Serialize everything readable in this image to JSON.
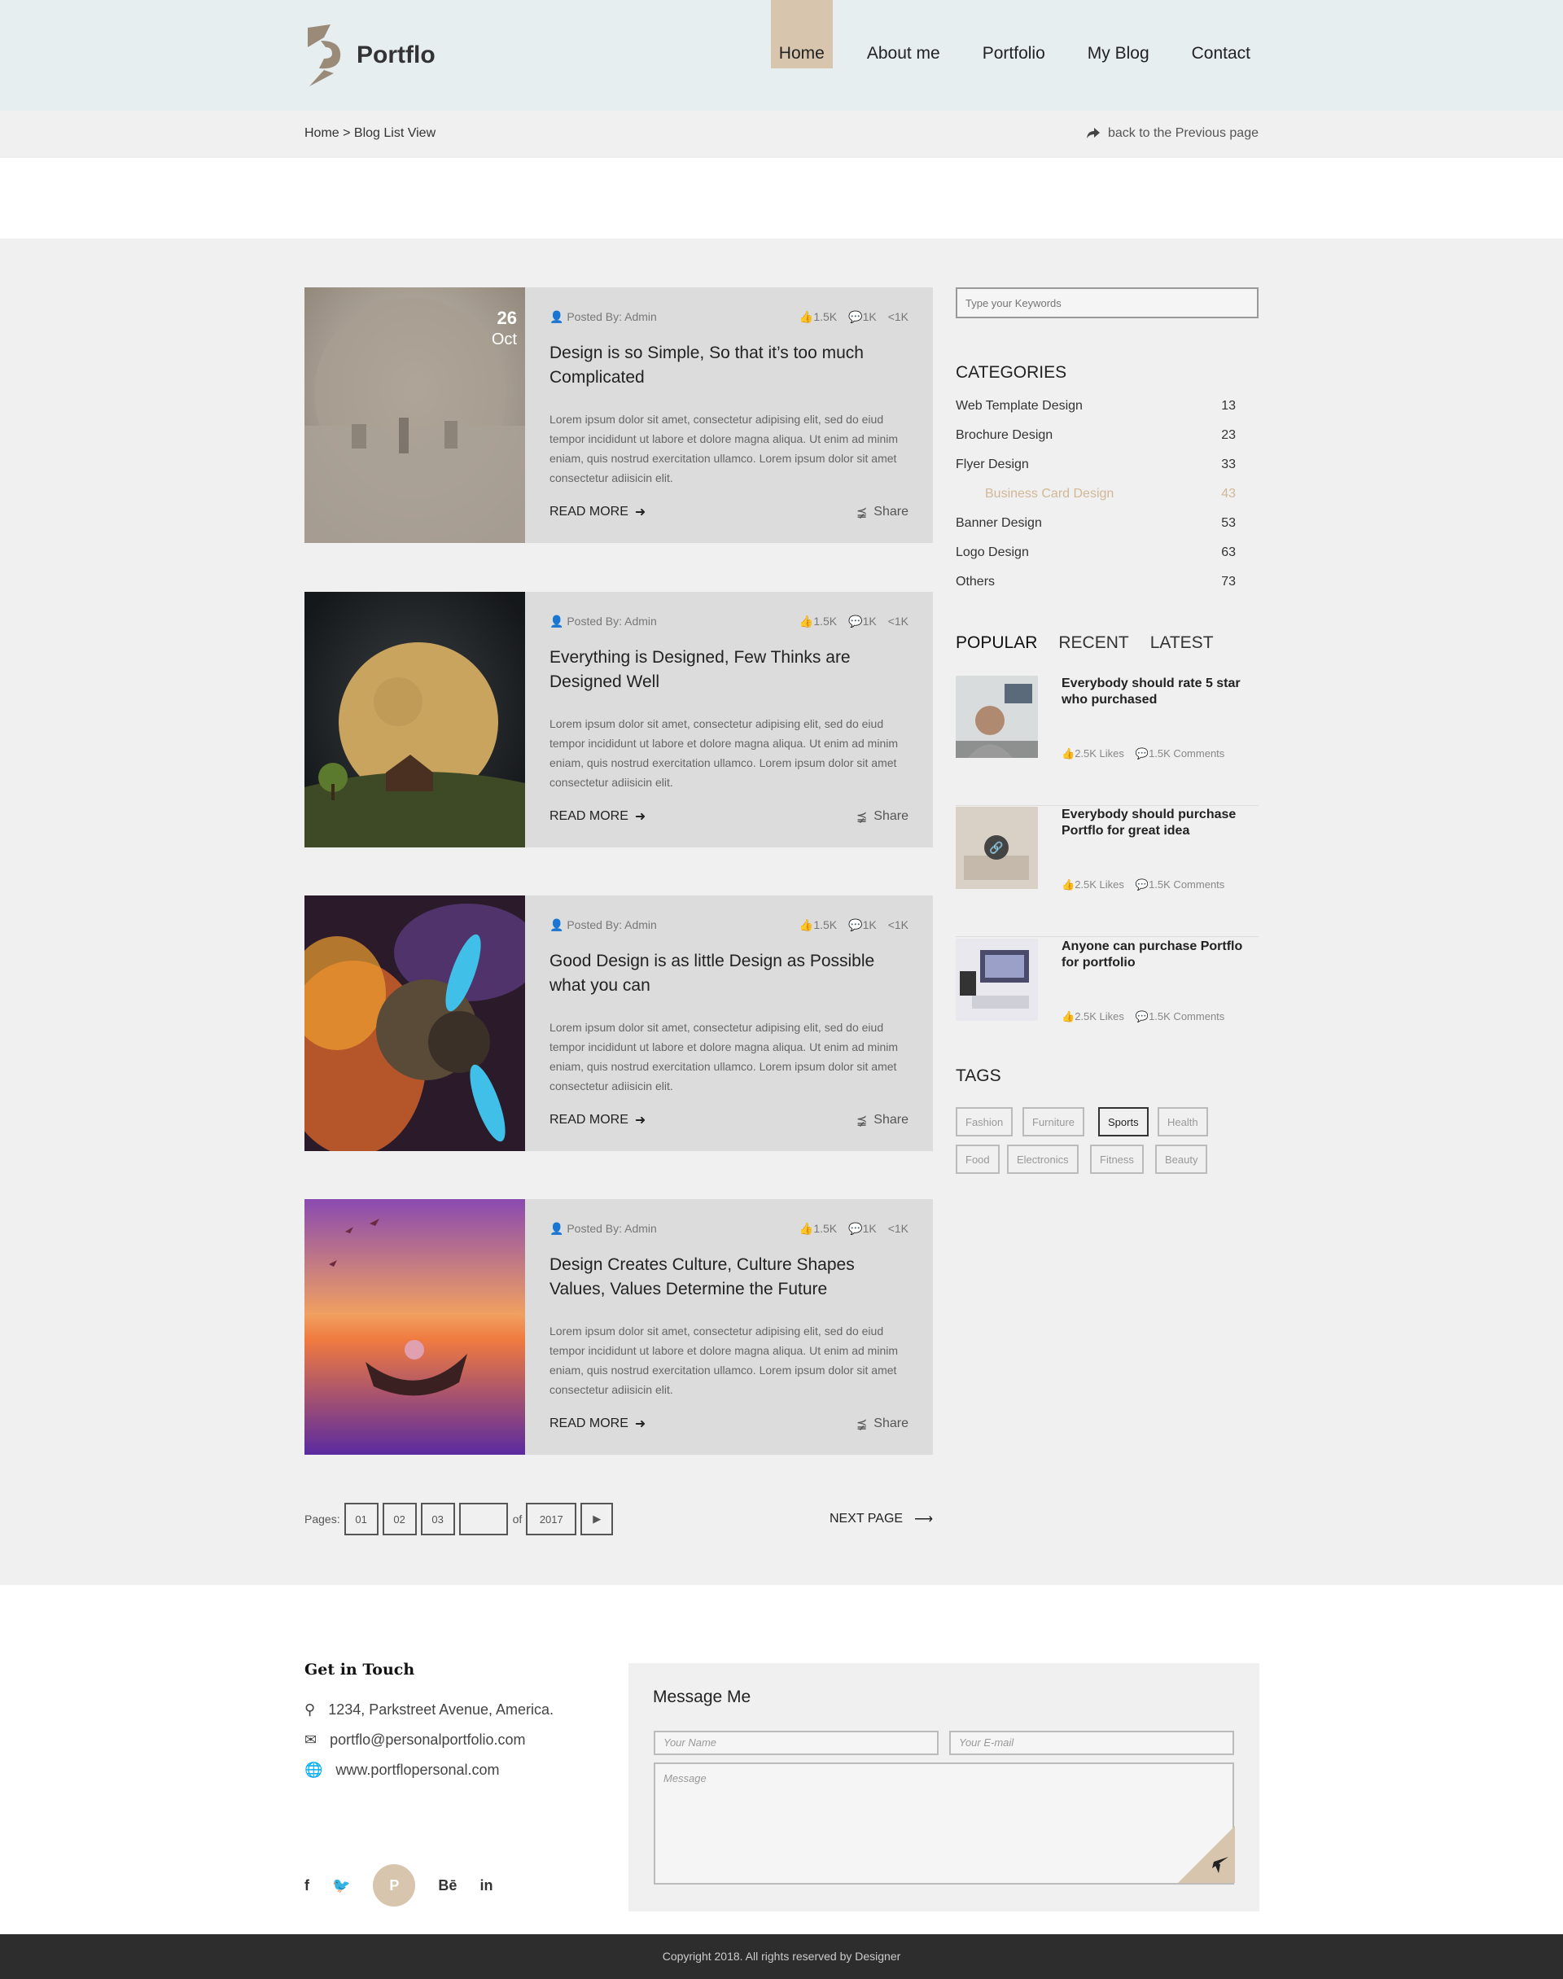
{
  "brand": {
    "name": "Portflo",
    "accent": "#d8c5ae",
    "logo_color": "#9a8a78"
  },
  "nav": {
    "items": [
      "Home",
      "About me",
      "Portfolio",
      "My Blog",
      "Contact"
    ],
    "active": "Home"
  },
  "breadcrumb": {
    "text": "Home > Blog List View",
    "back": "back to the Previous page"
  },
  "posts": [
    {
      "day": "26",
      "month": "Oct",
      "author": "Posted By: Admin",
      "likes": "1.5K",
      "comments": "1K",
      "shares": "1K",
      "title": "Design is so Simple, So that it’s too much Complicated",
      "excerpt": "Lorem ipsum dolor sit amet, consectetur adipising elit, sed do eiud tempor incididunt ut labore et dolore magna aliqua. Ut enim ad minim eniam, quis nostrud exercitation ullamco. Lorem ipsum dolor sit amet consectetur adiisicin elit.",
      "read_more": "READ MORE",
      "share": "Share"
    },
    {
      "author": "Posted By: Admin",
      "likes": "1.5K",
      "comments": "1K",
      "shares": "1K",
      "title": "Everything is Designed, Few Thinks are Designed Well",
      "excerpt": "Lorem ipsum dolor sit amet, consectetur adipising elit, sed do eiud tempor incididunt ut labore et dolore magna aliqua. Ut enim ad minim eniam, quis nostrud exercitation ullamco. Lorem ipsum dolor sit amet consectetur adiisicin elit.",
      "read_more": "READ MORE",
      "share": "Share"
    },
    {
      "author": "Posted By: Admin",
      "likes": "1.5K",
      "comments": "1K",
      "shares": "1K",
      "title": "Good Design is as little Design as Possible what you can",
      "excerpt": "Lorem ipsum dolor sit amet, consectetur adipising elit, sed do eiud tempor incididunt ut labore et dolore magna aliqua. Ut enim ad minim eniam, quis nostrud exercitation ullamco. Lorem ipsum dolor sit amet consectetur adiisicin elit.",
      "read_more": "READ MORE",
      "share": "Share"
    },
    {
      "author": "Posted By: Admin",
      "likes": "1.5K",
      "comments": "1K",
      "shares": "1K",
      "title": "Design Creates Culture, Culture Shapes Values, Values Determine the Future",
      "excerpt": "Lorem ipsum dolor sit amet, consectetur adipising elit, sed do eiud tempor incididunt ut labore et dolore magna aliqua. Ut enim ad minim eniam, quis nostrud exercitation ullamco. Lorem ipsum dolor sit amet consectetur adiisicin elit.",
      "read_more": "READ MORE",
      "share": "Share"
    }
  ],
  "pager": {
    "label": "Pages:",
    "pages": [
      "01",
      "02",
      "03"
    ],
    "current": "",
    "of": "of",
    "total": "2017",
    "next": "NEXT PAGE"
  },
  "search": {
    "placeholder": "Type your Keywords"
  },
  "categories": {
    "heading": "CATEGORIES",
    "items": [
      {
        "name": "Web Template Design",
        "count": "13"
      },
      {
        "name": "Brochure Design",
        "count": "23"
      },
      {
        "name": "Flyer Design",
        "count": "33"
      },
      {
        "name": "Business Card Design",
        "count": "43"
      },
      {
        "name": "Banner Design",
        "count": "53"
      },
      {
        "name": "Logo Design",
        "count": "63"
      },
      {
        "name": "Others",
        "count": "73"
      }
    ],
    "selected": "Business Card Design"
  },
  "popular": {
    "tabs": [
      "POPULAR",
      "RECENT",
      "LATEST"
    ],
    "items": [
      {
        "title": "Everybody should rate 5 star who purchased",
        "likes": "2.5K Likes",
        "comments": "1.5K Comments"
      },
      {
        "title": "Everybody should purchase Portflo for great idea",
        "likes": "2.5K Likes",
        "comments": "1.5K Comments"
      },
      {
        "title": "Anyone can purchase Portflo for portfolio",
        "likes": "2.5K Likes",
        "comments": "1.5K Comments"
      }
    ]
  },
  "tags": {
    "heading": "TAGS",
    "items": [
      "Fashion",
      "Furniture",
      "Sports",
      "Health",
      "Food",
      "Electronics",
      "Fitness",
      "Beauty"
    ],
    "selected": "Sports"
  },
  "contact": {
    "heading": "Get in Touch",
    "address": "1234, Parkstreet Avenue, America.",
    "email": "portflo@personalportfolio.com",
    "web": "www.portflopersonal.com"
  },
  "social": [
    "f",
    "twitter",
    "pinterest",
    "Bē",
    "in"
  ],
  "message": {
    "heading": "Message Me",
    "name_placeholder": "Your Name",
    "email_placeholder": "Your E-mail",
    "message_placeholder": "Message"
  },
  "footer": {
    "copyright": "Copyright 2018. All rights reserved by Designer"
  }
}
